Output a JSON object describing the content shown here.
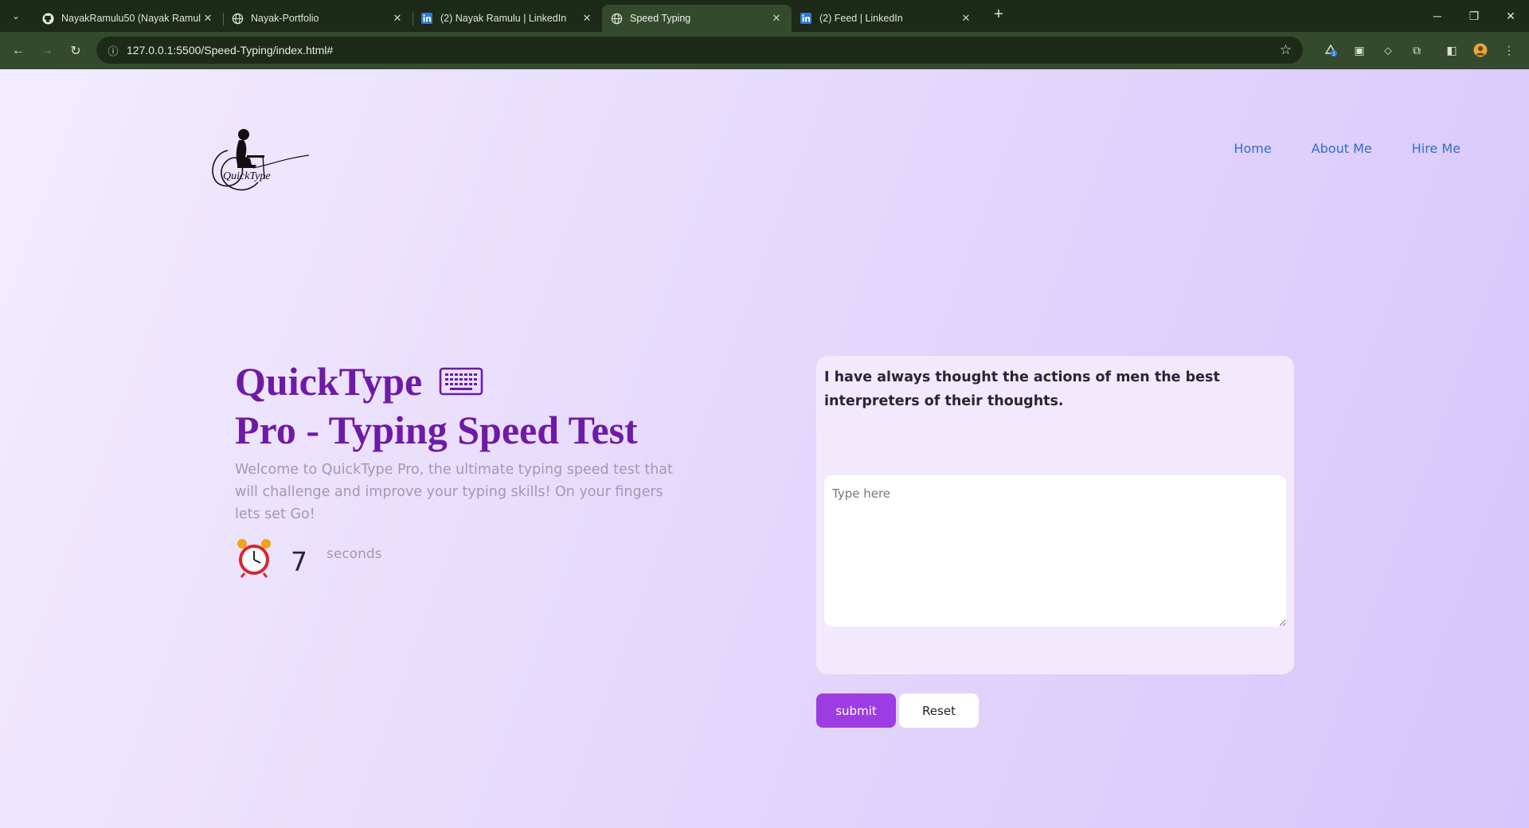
{
  "browser": {
    "tabs": [
      {
        "title": "NayakRamulu50 (Nayak Ramulu)",
        "favicon": "github-icon",
        "active": false
      },
      {
        "title": "Nayak-Portfolio",
        "favicon": "globe-icon",
        "active": false
      },
      {
        "title": "(2) Nayak Ramulu | LinkedIn",
        "favicon": "linkedin-icon",
        "active": false
      },
      {
        "title": "Speed Typing",
        "favicon": "globe-icon",
        "active": true
      },
      {
        "title": "(2) Feed | LinkedIn",
        "favicon": "linkedin-icon",
        "active": false
      }
    ],
    "url": "127.0.0.1:5500/Speed-Typing/index.html#"
  },
  "nav": {
    "links": [
      "Home",
      "About Me",
      "Hire Me"
    ]
  },
  "logo": {
    "text": "QuickType"
  },
  "hero": {
    "title_line1": "QuickType",
    "title_line2": "Pro - Typing Speed Test",
    "description": "Welcome to QuickType Pro, the ultimate typing speed test that will challenge and improve your typing skills! On your fingers lets set Go!"
  },
  "timer": {
    "value": "7",
    "unit": "seconds"
  },
  "test": {
    "quote": "I have always thought the actions of men the best interpreters of their thoughts.",
    "input_placeholder": "Type here",
    "input_value": ""
  },
  "buttons": {
    "submit": "submit",
    "reset": "Reset"
  },
  "colors": {
    "title_purple": "#6e1aa6",
    "submit_purple": "#9b3de2",
    "link_blue": "#2f6fc9"
  }
}
